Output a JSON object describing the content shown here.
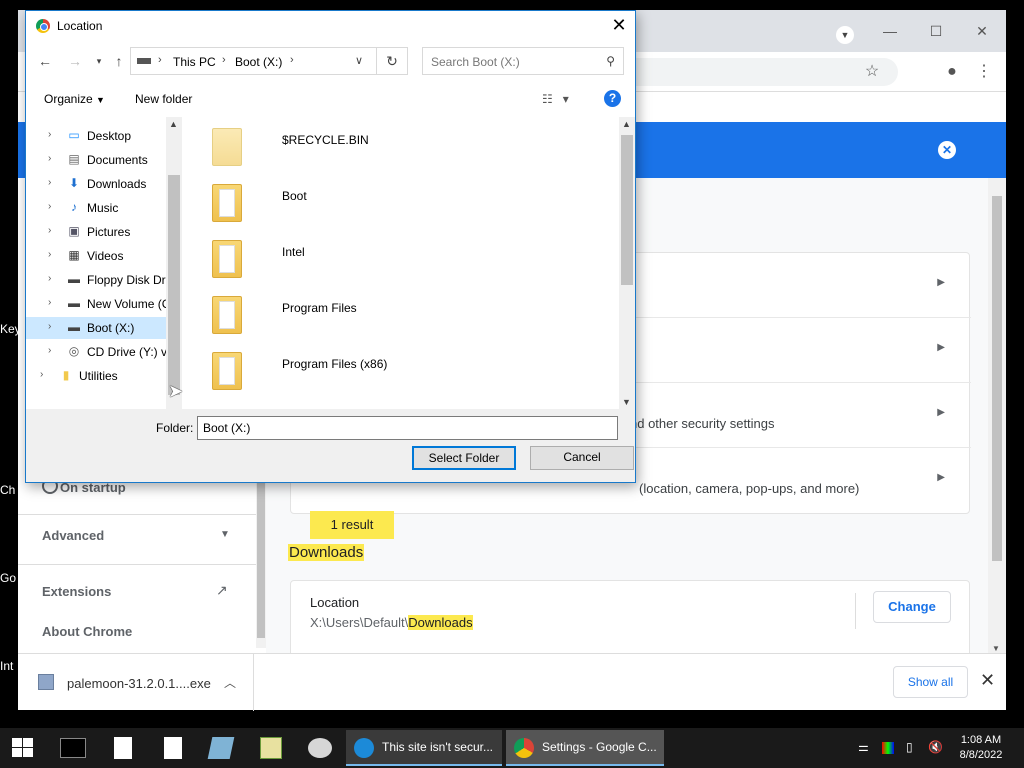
{
  "desktop": {
    "labels": [
      "Key",
      "Ch",
      "Go",
      "Int"
    ]
  },
  "chrome": {
    "sidebar": {
      "on_startup": "On startup",
      "advanced": "Advanced",
      "extensions": "Extensions",
      "about": "About Chrome"
    },
    "main": {
      "row3_text": "nd other security settings",
      "row4_text": "(location, camera, pop-ups, and more)",
      "result_badge": "1 result",
      "downloads_heading": "Downloads",
      "location_label": "Location",
      "location_path_prefix": "X:\\Users\\Default\\",
      "location_path_highlight": "Downloads",
      "change_button": "Change"
    },
    "download_shelf": {
      "file_name": "palemoon-31.2.0.1....exe",
      "show_all": "Show all"
    }
  },
  "dialog": {
    "title": "Location",
    "breadcrumb": [
      "This PC",
      "Boot (X:)"
    ],
    "search_placeholder": "Search Boot (X:)",
    "organize": "Organize",
    "new_folder": "New folder",
    "tree": [
      {
        "label": "Desktop",
        "icon": "desktop-icon"
      },
      {
        "label": "Documents",
        "icon": "documents-icon"
      },
      {
        "label": "Downloads",
        "icon": "downloads-icon"
      },
      {
        "label": "Music",
        "icon": "music-icon"
      },
      {
        "label": "Pictures",
        "icon": "pictures-icon"
      },
      {
        "label": "Videos",
        "icon": "videos-icon"
      },
      {
        "label": "Floppy Disk Dri",
        "icon": "floppy-drive-icon"
      },
      {
        "label": "New Volume (C",
        "icon": "drive-icon"
      },
      {
        "label": "Boot (X:)",
        "icon": "drive-icon",
        "selected": true
      },
      {
        "label": "CD Drive (Y:) vi",
        "icon": "cd-drive-icon"
      },
      {
        "label": "Utilities",
        "icon": "folder-icon"
      }
    ],
    "files": [
      {
        "name": "$RECYCLE.BIN",
        "faded": true
      },
      {
        "name": "Boot",
        "faded": false
      },
      {
        "name": "Intel",
        "faded": false
      },
      {
        "name": "Program Files",
        "faded": false
      },
      {
        "name": "Program Files (x86)",
        "faded": false
      }
    ],
    "folder_label": "Folder:",
    "folder_value": "Boot (X:)",
    "select_button": "Select Folder",
    "cancel_button": "Cancel"
  },
  "taskbar": {
    "tasks": [
      {
        "label": "This site isn't secur...",
        "icon": "ie-icon"
      },
      {
        "label": "Settings - Google C...",
        "icon": "chrome-icon",
        "active": true
      }
    ],
    "time": "1:08 AM",
    "date": "8/8/2022"
  },
  "colors": {
    "accent": "#1a73e8",
    "highlight": "#fce94f",
    "selection": "#cce8ff"
  }
}
